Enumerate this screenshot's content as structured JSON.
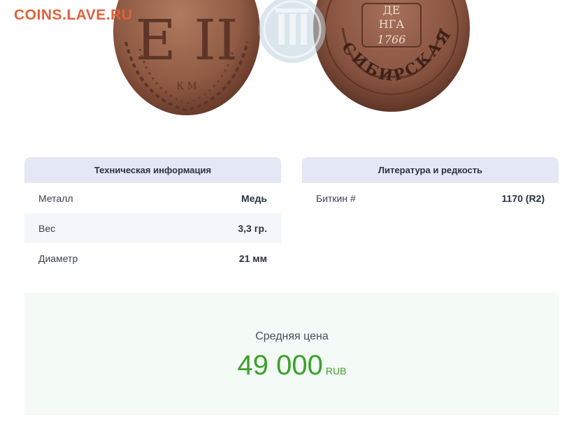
{
  "watermark": "COINS.LAVE.RU",
  "coin_image": {
    "obverse_monogram": "Е II",
    "obverse_mint": "К М",
    "reverse_denomination_1": "ДЕ",
    "reverse_denomination_2": "НГА",
    "reverse_year": "1766",
    "reverse_legend": "СИБИРСКАЯ МОНЕТА",
    "watermark_logo_icon": "coins-lave-logo-icon",
    "colors": {
      "copper": "#8f5a43",
      "copper_dark": "#5e3526",
      "copper_light": "#b07a60"
    }
  },
  "tech_info": {
    "title": "Техническая информация",
    "rows": [
      {
        "label": "Металл",
        "value": "Медь"
      },
      {
        "label": "Вес",
        "value": "3,3 гр."
      },
      {
        "label": "Диаметр",
        "value": "21 мм"
      }
    ]
  },
  "literature": {
    "title": "Литература и редкость",
    "rows": [
      {
        "label": "Биткин #",
        "value": "1170 (R2)"
      }
    ]
  },
  "price": {
    "label": "Средняя цена",
    "value": "49 000",
    "currency": "RUB",
    "color": "#3aa22a"
  }
}
